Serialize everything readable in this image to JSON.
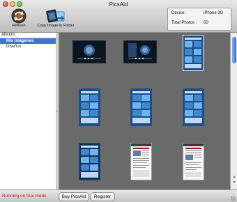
{
  "window": {
    "title": "PicsAid"
  },
  "toolbar": {
    "refresh_label": "Refresh",
    "refresh_icon": "refresh-icon",
    "copy_label": "Copy Image to Folder",
    "copy_icon": "copy-to-folder-icon"
  },
  "device_info": {
    "device_label": "Device:",
    "device_value": "iPhone 3G",
    "photos_label": "Total Photos :",
    "photos_value": "50"
  },
  "sidebar": {
    "header": "Albums",
    "items": [
      {
        "label": "Mis Imágenes",
        "selected": true
      },
      {
        "label": "Diseños",
        "selected": false
      }
    ]
  },
  "gallery": {
    "thumbnails": [
      {
        "kind": "landscape"
      },
      {
        "kind": "landscape"
      },
      {
        "kind": "portrait"
      },
      {
        "kind": "portrait"
      },
      {
        "kind": "portrait"
      },
      {
        "kind": "portrait"
      },
      {
        "kind": "portrait"
      },
      {
        "kind": "document"
      },
      {
        "kind": "document"
      }
    ]
  },
  "status": {
    "trial_text": "Running on trial mode"
  },
  "footer": {
    "buy_label": "Buy PicsAid",
    "register_label": "Register"
  },
  "colors": {
    "selection": "#3f74d6",
    "trial_text": "#dd1111",
    "gallery_background": "#6a6a6a"
  }
}
